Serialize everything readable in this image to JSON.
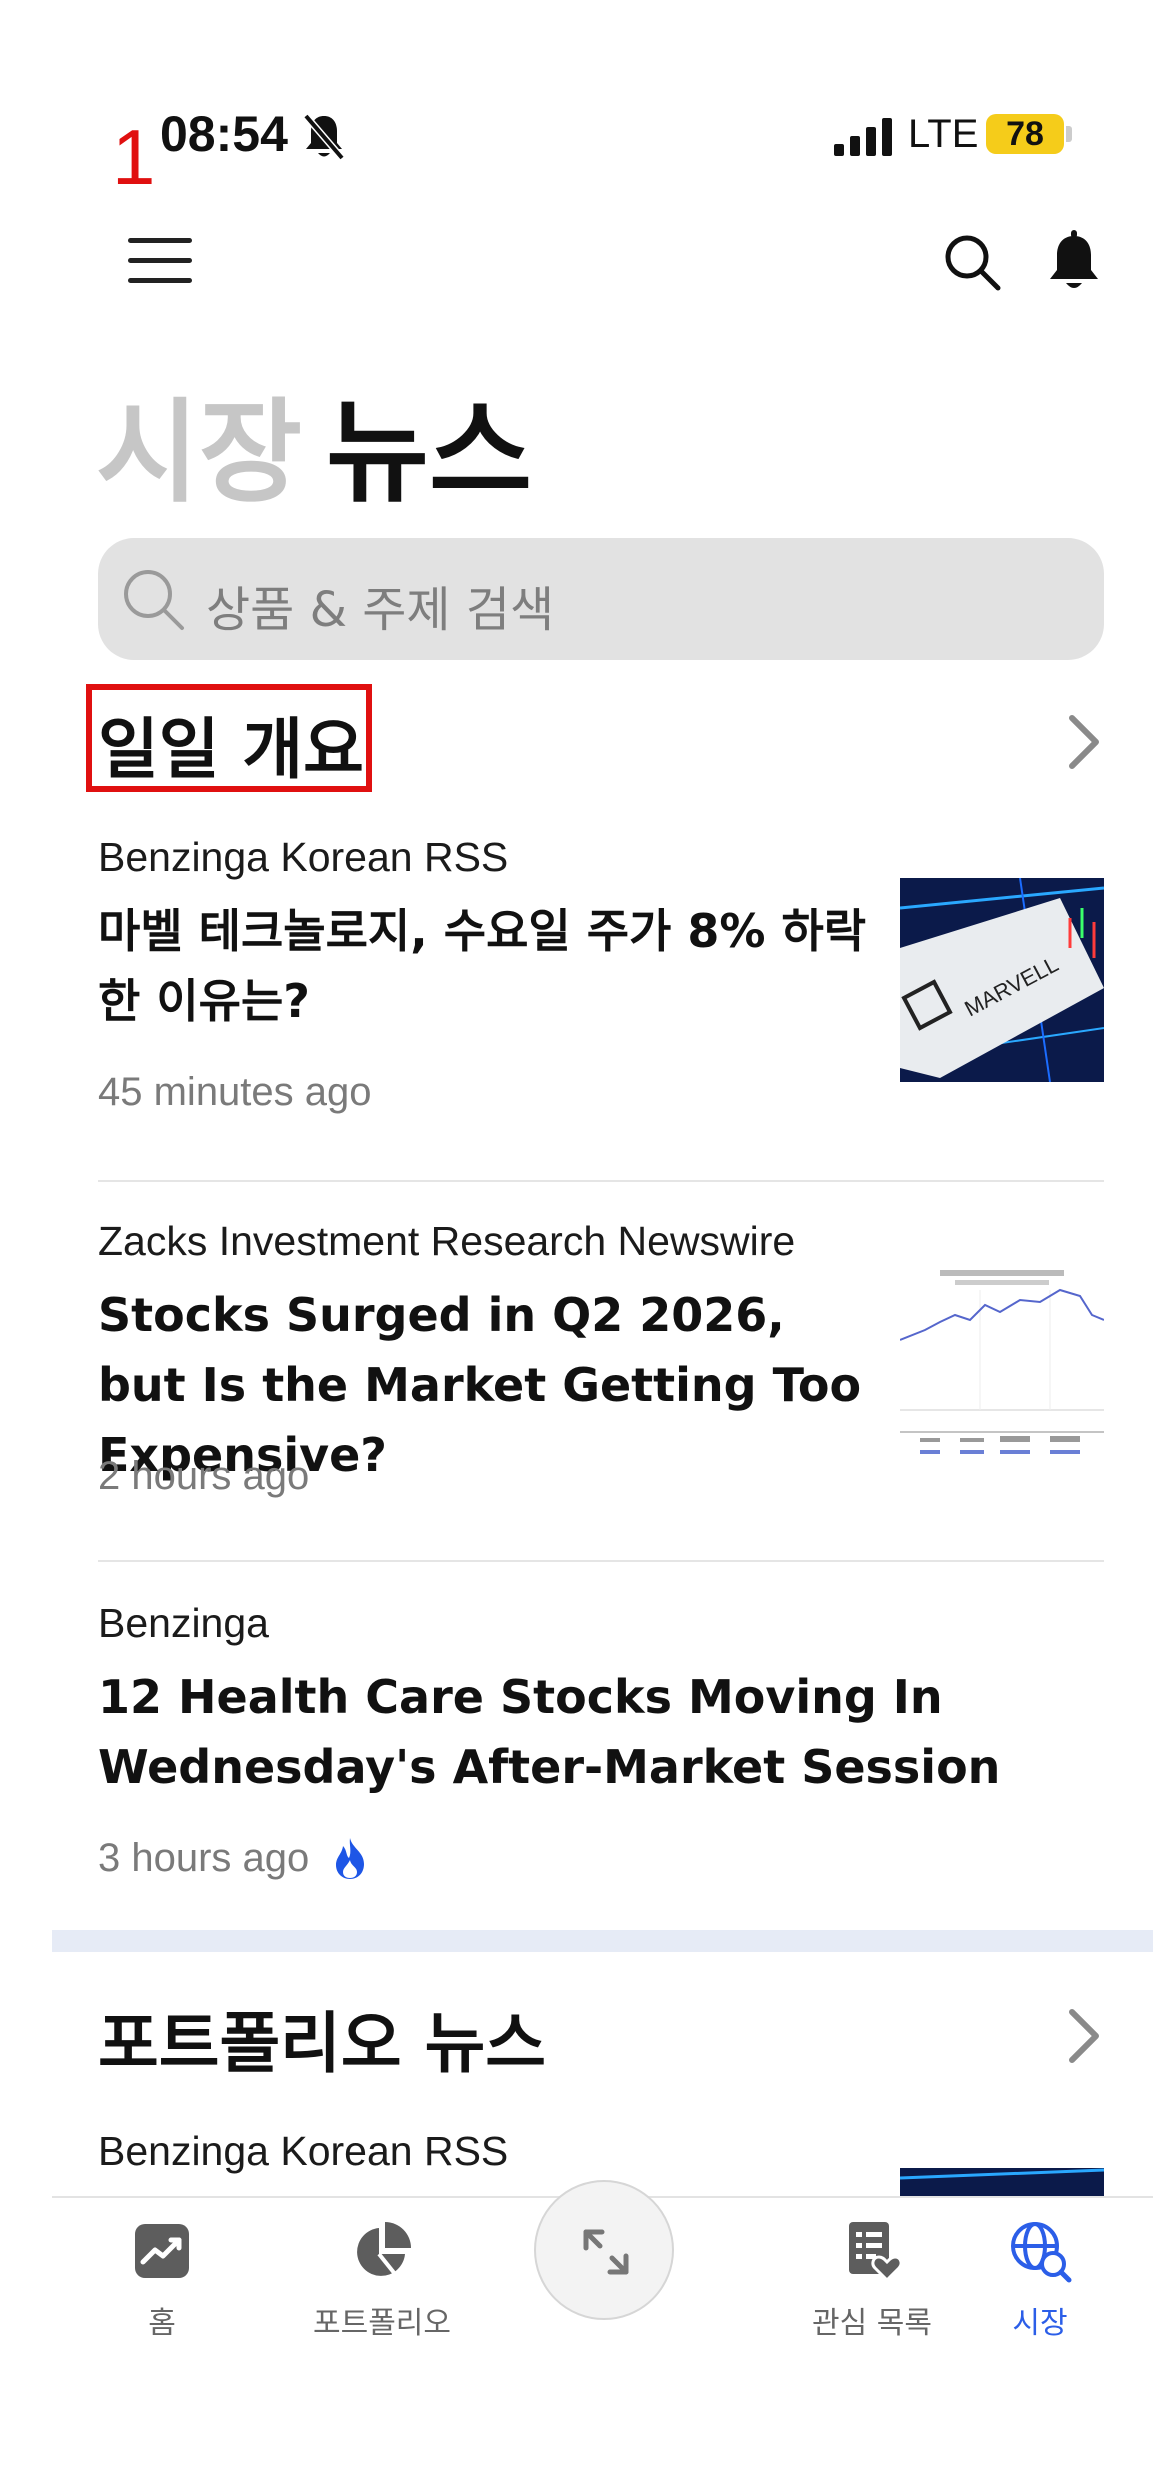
{
  "status_bar": {
    "annotation_number": "1",
    "time": "08:54",
    "network": "LTE",
    "battery": "78"
  },
  "header": {
    "tab_market": "시장",
    "tab_news": "뉴스"
  },
  "search": {
    "placeholder": "상품 & 주제 검색"
  },
  "daily_overview": {
    "title": "일일 개요",
    "articles": [
      {
        "source": "Benzinga Korean RSS",
        "title": "마벨 테크놀로지, 수요일 주가 8% 하락한 이유는?",
        "time": "45 minutes ago",
        "thumb_text": "MARVELL"
      },
      {
        "source": "Zacks Investment Research Newswire",
        "title": "Stocks Surged in Q2 2026, but Is the Market Getting Too Expensive?",
        "time": "2 hours ago"
      },
      {
        "source": "Benzinga",
        "title": "12 Health Care Stocks Moving In Wednesday's After-Market Session",
        "time": "3 hours ago"
      }
    ]
  },
  "portfolio_news": {
    "title": "포트폴리오 뉴스",
    "articles": [
      {
        "source": "Benzinga Korean RSS"
      }
    ]
  },
  "tabbar": {
    "home": "홈",
    "portfolio": "포트폴리오",
    "watchlist": "관심 목록",
    "market": "시장"
  },
  "colors": {
    "accent": "#2b5ee8",
    "annotation_red": "#e01010",
    "battery": "#f5cc1a"
  }
}
